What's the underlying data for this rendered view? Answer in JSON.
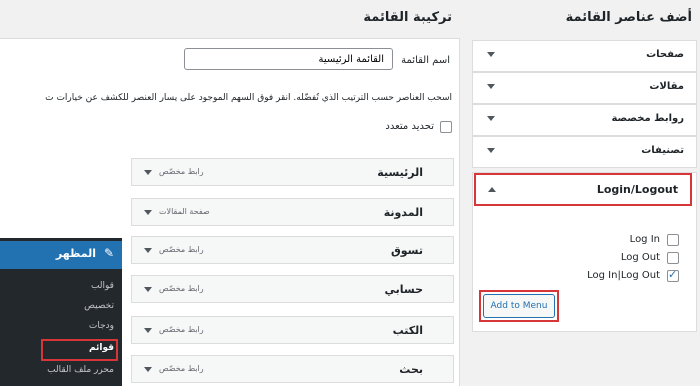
{
  "headings": {
    "add_items": "أضف عناصر القائمة",
    "menu_structure": "تركيبة القائمة"
  },
  "add_panel": {
    "sections": [
      "صفحات",
      "مقالات",
      "روابط مخصصة",
      "تصنيفات"
    ],
    "login_section": "Login/Logout",
    "options": [
      {
        "label": "Log In",
        "checked": false
      },
      {
        "label": "Log Out",
        "checked": false
      },
      {
        "label": "Log In|Log Out",
        "checked": true
      }
    ],
    "add_button": "Add to Menu"
  },
  "menu": {
    "name_label": "اسم القائمة",
    "name_value": "القائمة الرئيسية",
    "instructions": "اسحب العناصر حسب الترتيب الذي تُفضّله. أنقر فوق السهم الموجود على يسار العنصر للكشف عن خيارات ت",
    "bulk_select": "تحديد متعدد",
    "items": [
      {
        "title": "الرئيسية",
        "type": "رابط مخصّص"
      },
      {
        "title": "المدونة",
        "type": "صفحة المقالات"
      },
      {
        "title": "تسوق",
        "type": "رابط مخصّص"
      },
      {
        "title": "حسابي",
        "type": "رابط مخصّص"
      },
      {
        "title": "الكتب",
        "type": "رابط مخصّص"
      },
      {
        "title": "بحث",
        "type": "رابط مخصّص"
      }
    ]
  },
  "admin_menu": {
    "title": "المظهر",
    "items": [
      "قوالب",
      "تخصيص",
      "ودجات",
      "قوائم",
      "محرر ملف القالب"
    ],
    "active": "قوائم"
  }
}
